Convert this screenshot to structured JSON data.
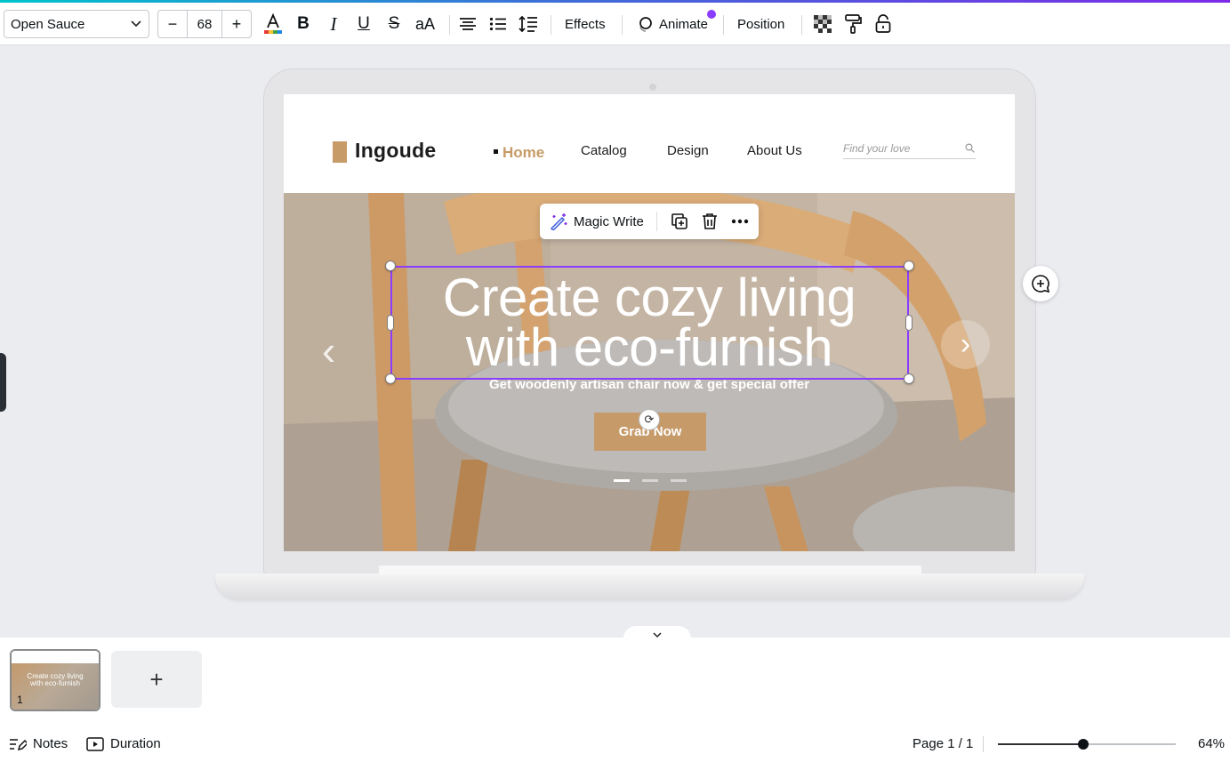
{
  "toolbar": {
    "font_family": "Open Sauce",
    "font_size": "68",
    "decrease": "−",
    "increase": "+",
    "case_label": "aA",
    "effects_label": "Effects",
    "animate_label": "Animate",
    "position_label": "Position"
  },
  "design": {
    "brand": "Ingoude",
    "nav": [
      "Home",
      "Catalog",
      "Design",
      "About Us"
    ],
    "search_placeholder": "Find your love",
    "hero_title_line1": "Create cozy living",
    "hero_title_line2": "with eco-furnish",
    "hero_subtitle": "Get woodenly artisan chair now & get special offer",
    "cta_label": "Grab Now",
    "accent_color": "#c79b67"
  },
  "context_menu": {
    "magic_write_label": "Magic Write"
  },
  "pages": {
    "current_thumb_number": "1",
    "add_label": "+"
  },
  "footer": {
    "notes_label": "Notes",
    "duration_label": "Duration",
    "page_indicator": "Page 1 / 1",
    "zoom_label": "64%",
    "zoom_fraction": 0.48
  },
  "colors": {
    "selection": "#8b3dff",
    "animate_badge": "#8b3dff"
  },
  "icons": [
    "chevron-down-icon",
    "text-color-icon",
    "bold-icon",
    "italic-icon",
    "underline-icon",
    "strikethrough-icon",
    "align-center-icon",
    "list-icon",
    "spacing-icon",
    "transparency-icon",
    "paint-roller-icon",
    "lock-icon",
    "magic-write-icon",
    "duplicate-icon",
    "trash-icon",
    "more-icon",
    "comment-add-icon",
    "rotate-icon",
    "notes-icon",
    "duration-icon"
  ]
}
